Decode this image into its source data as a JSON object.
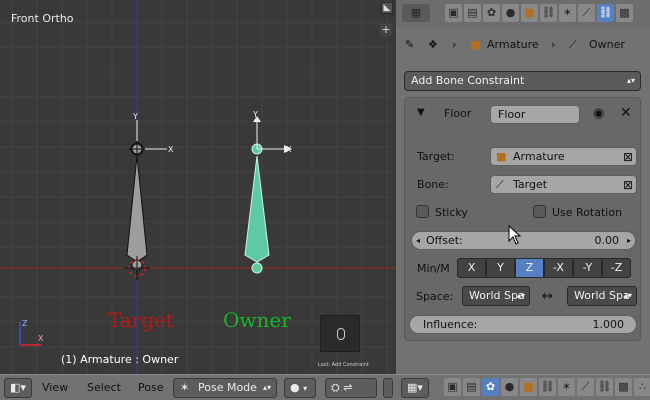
{
  "viewport": {
    "title": "Front Ortho",
    "target_label": "Target",
    "owner_label": "Owner",
    "status": "(1) Armature : Owner",
    "operator_caption": "Last: Add Constraint"
  },
  "bottombar": {
    "menus": [
      "View",
      "Select",
      "Pose"
    ],
    "mode": "Pose Mode"
  },
  "props": {
    "breadcrumb": {
      "object": "Armature",
      "bone": "Owner"
    },
    "add_constraint": "Add Bone Constraint",
    "constraint": {
      "type": "Floor",
      "name": "Floor",
      "target_label": "Target:",
      "target_value": "Armature",
      "bone_label": "Bone:",
      "bone_value": "Target",
      "sticky_label": "Sticky",
      "use_rotation_label": "Use Rotation",
      "offset_label": "Offset:",
      "offset_value": "0.00",
      "minm_label": "Min/M",
      "axes": [
        "X",
        "Y",
        "Z",
        "-X",
        "-Y",
        "-Z"
      ],
      "active_axis": "Z",
      "space_label": "Space:",
      "space_owner": "World Spa",
      "space_target": "World Spa",
      "influence_label": "Influence:",
      "influence_value": "1.000"
    }
  },
  "colors": {
    "accent": "#5680c2",
    "target_text": "#b51b1b",
    "owner_text": "#1bb52a",
    "owner_bone": "#5ec9a4"
  }
}
